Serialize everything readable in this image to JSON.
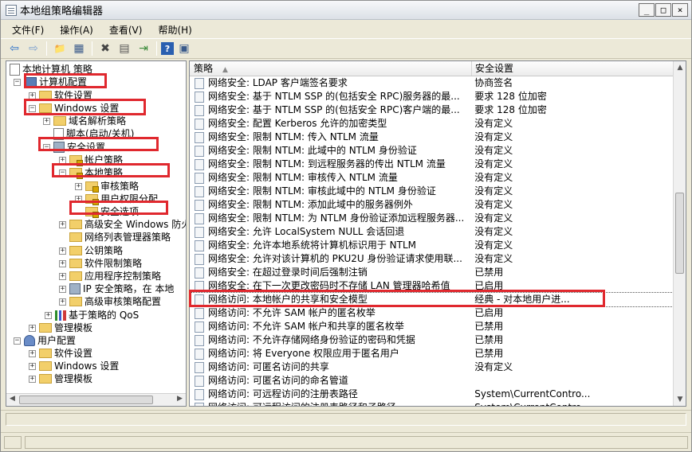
{
  "window": {
    "title": "本地组策略编辑器",
    "min": "_",
    "max": "□",
    "close": "×"
  },
  "menu": [
    "文件(F)",
    "操作(A)",
    "查看(V)",
    "帮助(H)"
  ],
  "toolbar": {
    "back": "⇦",
    "forward": "⇨",
    "up": "📁",
    "view": "▦",
    "delete": "✖",
    "props": "▤",
    "export": "⇥",
    "help": "?",
    "console": "▣"
  },
  "tree": [
    {
      "label": "本地计算机 策略",
      "icon": "document-icon",
      "exp": ""
    },
    {
      "label": "计算机配置",
      "icon": "computer-icon",
      "exp": "−"
    },
    {
      "label": "软件设置",
      "icon": "folder-icon",
      "exp": "+"
    },
    {
      "label": "Windows 设置",
      "icon": "folder-icon",
      "exp": "−"
    },
    {
      "label": "域名解析策略",
      "icon": "folder-icon",
      "exp": "+"
    },
    {
      "label": "脚本(启动/关机)",
      "icon": "script-icon",
      "exp": ""
    },
    {
      "label": "安全设置",
      "icon": "security-icon",
      "exp": "−"
    },
    {
      "label": "帐户策略",
      "icon": "folder-lock-icon",
      "exp": "+"
    },
    {
      "label": "本地策略",
      "icon": "folder-lock-icon",
      "exp": "−"
    },
    {
      "label": "审核策略",
      "icon": "folder-lock-icon",
      "exp": "+"
    },
    {
      "label": "用户权限分配",
      "icon": "folder-lock-icon",
      "exp": "+"
    },
    {
      "label": "安全选项",
      "icon": "folder-lock-icon",
      "exp": ""
    },
    {
      "label": "高级安全 Windows 防火",
      "icon": "folder-icon",
      "exp": "+"
    },
    {
      "label": "网络列表管理器策略",
      "icon": "folder-icon",
      "exp": ""
    },
    {
      "label": "公钥策略",
      "icon": "folder-icon",
      "exp": "+"
    },
    {
      "label": "软件限制策略",
      "icon": "folder-icon",
      "exp": "+"
    },
    {
      "label": "应用程序控制策略",
      "icon": "folder-icon",
      "exp": "+"
    },
    {
      "label": "IP 安全策略，在 本地",
      "icon": "shield-icon",
      "exp": "+"
    },
    {
      "label": "高级审核策略配置",
      "icon": "folder-icon",
      "exp": "+"
    },
    {
      "label": "基于策略的 QoS",
      "icon": "chart-icon",
      "exp": "+"
    },
    {
      "label": "管理模板",
      "icon": "folder-icon",
      "exp": "+"
    },
    {
      "label": "用户配置",
      "icon": "user-icon",
      "exp": "−"
    },
    {
      "label": "软件设置",
      "icon": "folder-icon",
      "exp": "+"
    },
    {
      "label": "Windows 设置",
      "icon": "folder-icon",
      "exp": "+"
    },
    {
      "label": "管理模板",
      "icon": "folder-icon",
      "exp": "+"
    }
  ],
  "list": {
    "col_policy": "策略",
    "col_setting": "安全设置",
    "rows": [
      {
        "policy": "网络安全: LDAP 客户端签名要求",
        "setting": "协商签名"
      },
      {
        "policy": "网络安全: 基于 NTLM SSP 的(包括安全 RPC)服务器的最...",
        "setting": "要求 128 位加密"
      },
      {
        "policy": "网络安全: 基于 NTLM SSP 的(包括安全 RPC)客户端的最...",
        "setting": "要求 128 位加密"
      },
      {
        "policy": "网络安全: 配置 Kerberos 允许的加密类型",
        "setting": "没有定义"
      },
      {
        "policy": "网络安全: 限制 NTLM: 传入 NTLM 流量",
        "setting": "没有定义"
      },
      {
        "policy": "网络安全: 限制 NTLM: 此域中的 NTLM 身份验证",
        "setting": "没有定义"
      },
      {
        "policy": "网络安全: 限制 NTLM: 到远程服务器的传出 NTLM 流量",
        "setting": "没有定义"
      },
      {
        "policy": "网络安全: 限制 NTLM: 审核传入 NTLM 流量",
        "setting": "没有定义"
      },
      {
        "policy": "网络安全: 限制 NTLM: 审核此域中的 NTLM 身份验证",
        "setting": "没有定义"
      },
      {
        "policy": "网络安全: 限制 NTLM: 添加此域中的服务器例外",
        "setting": "没有定义"
      },
      {
        "policy": "网络安全: 限制 NTLM: 为 NTLM 身份验证添加远程服务器...",
        "setting": "没有定义"
      },
      {
        "policy": "网络安全: 允许 LocalSystem NULL 会话回退",
        "setting": "没有定义"
      },
      {
        "policy": "网络安全: 允许本地系统将计算机标识用于 NTLM",
        "setting": "没有定义"
      },
      {
        "policy": "网络安全: 允许对该计算机的 PKU2U 身份验证请求使用联...",
        "setting": "没有定义"
      },
      {
        "policy": "网络安全: 在超过登录时间后强制注销",
        "setting": "已禁用"
      },
      {
        "policy": "网络安全: 在下一次更改密码时不存储 LAN 管理器哈希值",
        "setting": "已启用"
      },
      {
        "policy": "网络访问: 本地帐户的共享和安全模型",
        "setting": "经典 - 对本地用户进..."
      },
      {
        "policy": "网络访问: 不允许 SAM 帐户的匿名枚举",
        "setting": "已启用"
      },
      {
        "policy": "网络访问: 不允许 SAM 帐户和共享的匿名枚举",
        "setting": "已禁用"
      },
      {
        "policy": "网络访问: 不允许存储网络身份验证的密码和凭据",
        "setting": "已禁用"
      },
      {
        "policy": "网络访问: 将 Everyone 权限应用于匿名用户",
        "setting": "已禁用"
      },
      {
        "policy": "网络访问: 可匿名访问的共享",
        "setting": "没有定义"
      },
      {
        "policy": "网络访问: 可匿名访问的命名管道",
        "setting": ""
      },
      {
        "policy": "网络访问: 可远程访问的注册表路径",
        "setting": "System\\CurrentContro..."
      },
      {
        "policy": "网络访问: 可远程访问的注册表路径和子路径",
        "setting": "System\\CurrentContro..."
      }
    ]
  },
  "scroll": {
    "up": "▲",
    "down": "▼",
    "left": "◀",
    "right": "▶"
  }
}
